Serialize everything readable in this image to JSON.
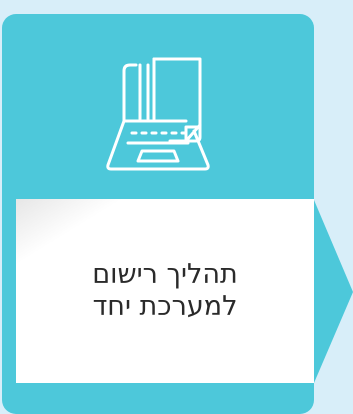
{
  "card": {
    "title": "תהליך רישום למערכת יחד",
    "icon": "laptop-document-icon",
    "colors": {
      "accent": "#4dc8da",
      "panel": "#ffffff",
      "background": "#d8eef9"
    }
  }
}
